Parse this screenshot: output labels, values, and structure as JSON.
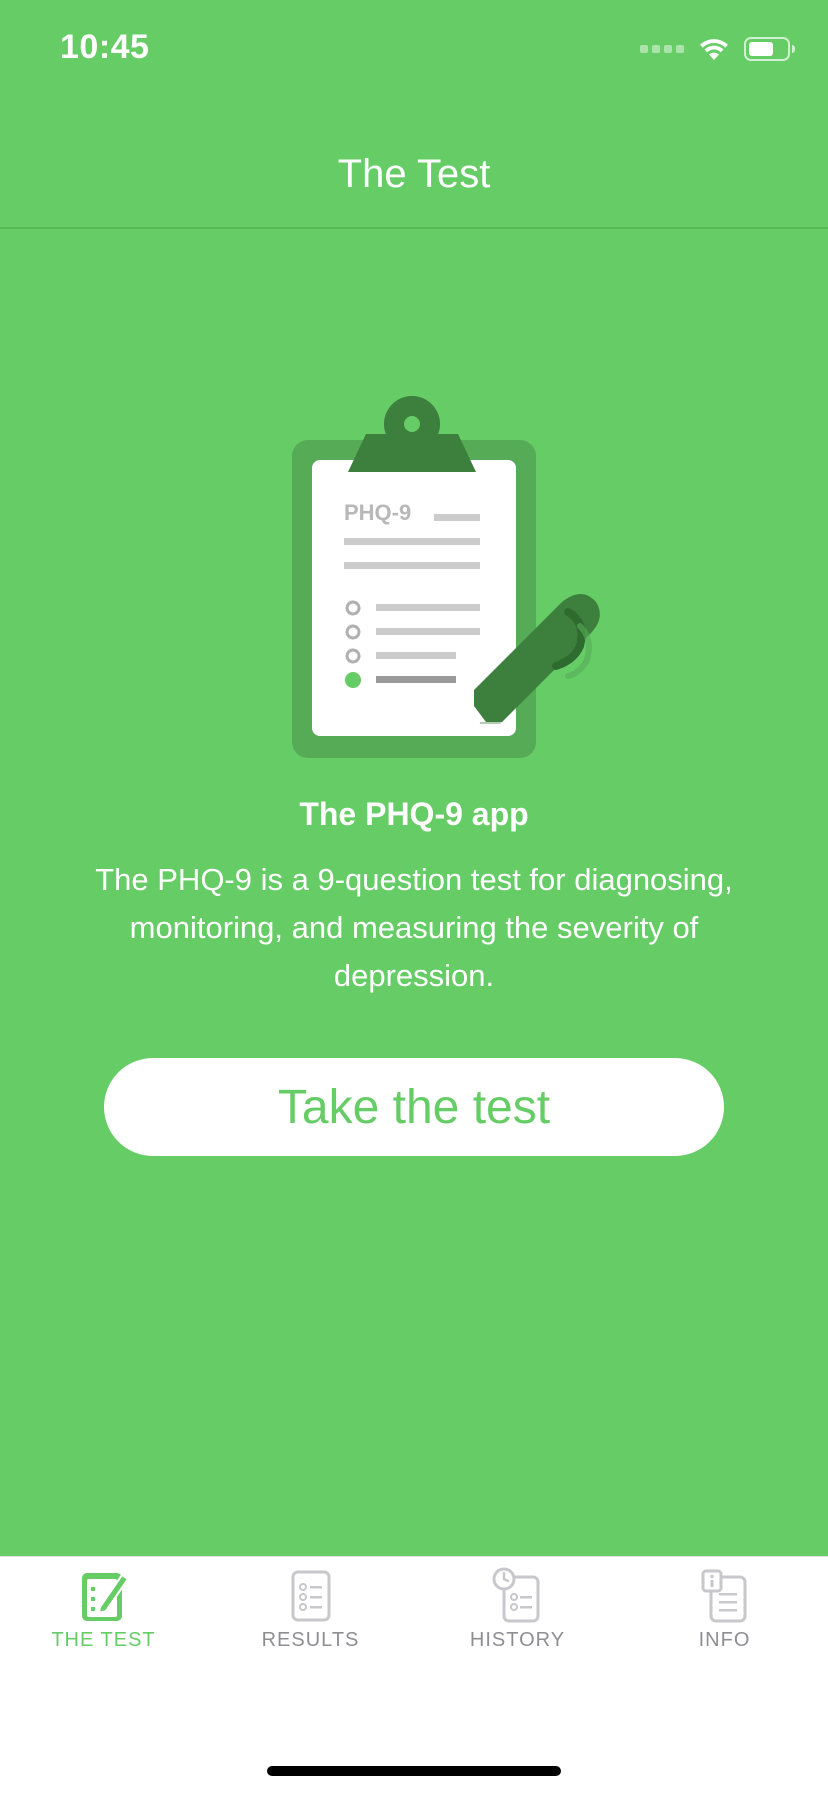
{
  "status_bar": {
    "time": "10:45"
  },
  "nav": {
    "title": "The Test"
  },
  "illustration": {
    "clipboard_label": "PHQ-9"
  },
  "main": {
    "headline": "The PHQ-9 app",
    "description": "The PHQ-9 is a 9-question test for diagnosing, monitoring, and measuring the severity of depression.",
    "cta_label": "Take the test"
  },
  "tabs": [
    {
      "label": "THE TEST",
      "icon": "clipboard-pencil-icon",
      "active": true
    },
    {
      "label": "RESULTS",
      "icon": "checklist-icon",
      "active": false
    },
    {
      "label": "HISTORY",
      "icon": "clock-checklist-icon",
      "active": false
    },
    {
      "label": "INFO",
      "icon": "info-document-icon",
      "active": false
    }
  ],
  "colors": {
    "brand_green": "#66cc66",
    "dark_green": "#3a7a3a",
    "tab_inactive": "#8e8e93",
    "white": "#ffffff"
  }
}
